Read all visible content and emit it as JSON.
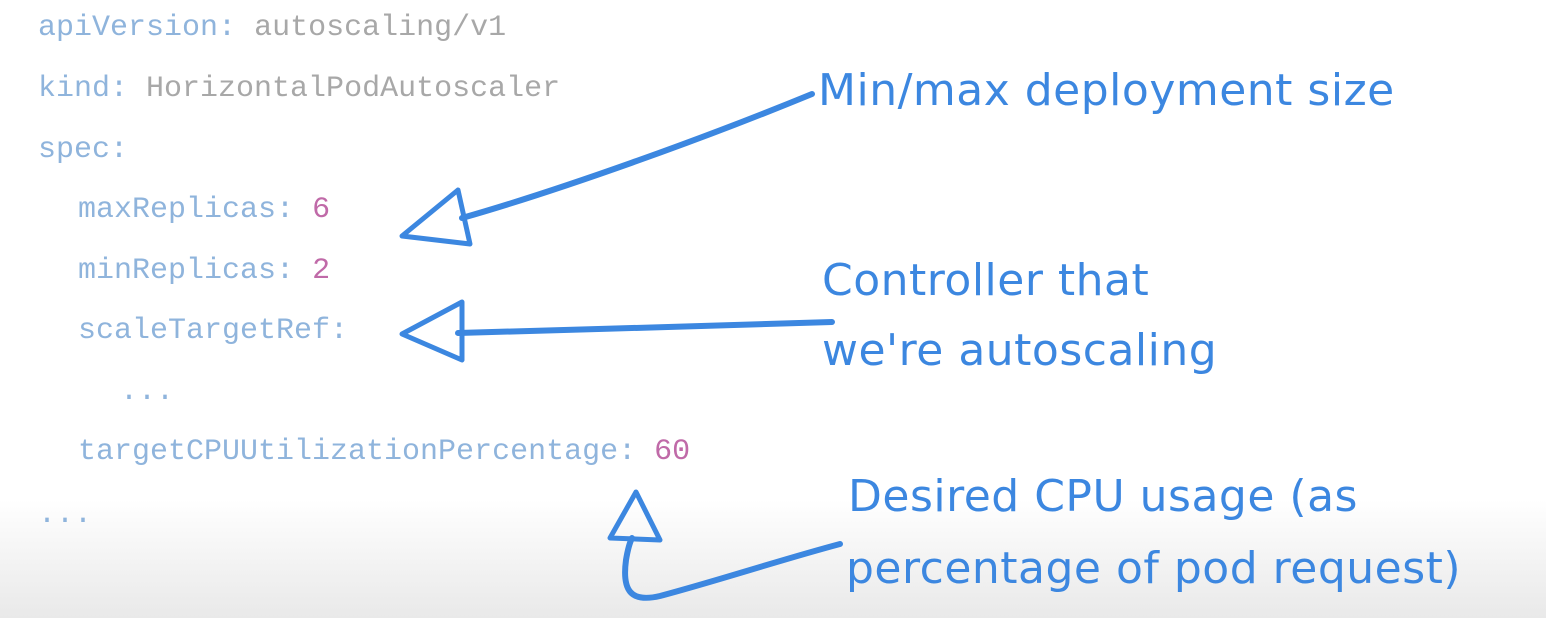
{
  "code": {
    "apiVersion_key": "apiVersion:",
    "apiVersion_val": "autoscaling/v1",
    "kind_key": "kind:",
    "kind_val": "HorizontalPodAutoscaler",
    "spec_key": "spec:",
    "maxReplicas_key": "maxReplicas:",
    "maxReplicas_val": "6",
    "minReplicas_key": "minReplicas:",
    "minReplicas_val": "2",
    "scaleTargetRef_key": "scaleTargetRef:",
    "inner_ellipsis": "...",
    "targetCPU_key": "targetCPUUtilizationPercentage:",
    "targetCPU_val": "60",
    "trailing_ellipsis": "..."
  },
  "annotations": {
    "minmax": "Min/max deployment size",
    "controller_line1": "Controller that",
    "controller_line2": "we're autoscaling",
    "cpu_line1": "Desired CPU usage (as",
    "cpu_line2": "percentage of pod request)"
  },
  "colors": {
    "key": "#8fb4dc",
    "value": "#a8a8a8",
    "number": "#c06aa8",
    "annotation": "#3c87e0"
  }
}
